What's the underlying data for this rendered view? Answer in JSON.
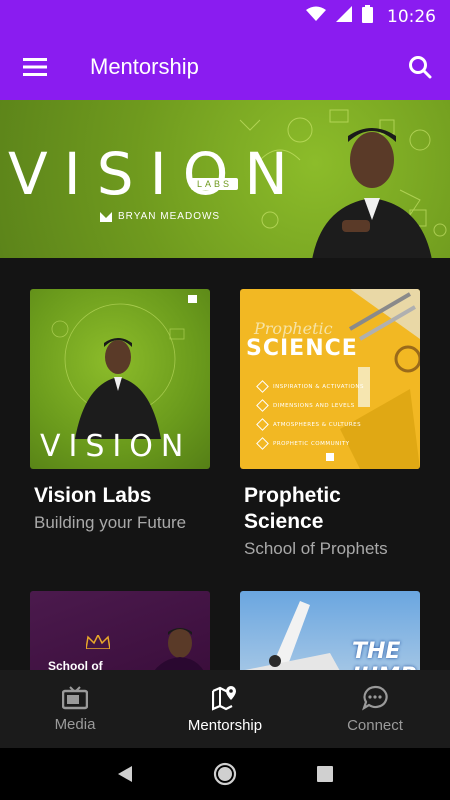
{
  "status_bar": {
    "time": "10:26",
    "icons": [
      "wifi-icon",
      "signal-icon",
      "battery-icon"
    ]
  },
  "app_bar": {
    "title": "Mentorship",
    "menu_icon": "hamburger-menu-icon",
    "search_icon": "search-icon",
    "color": "#8a1cf0"
  },
  "hero": {
    "title": "VISION",
    "badge": "LABS",
    "author": "BRYAN MEADOWS"
  },
  "cards": [
    {
      "title": "Vision Labs",
      "subtitle": "Building your Future",
      "thumb_word": "VISION"
    },
    {
      "title": "Prophetic Science",
      "subtitle": "School of Prophets",
      "thumb_script": "Prophetic",
      "thumb_big": "SCIENCE",
      "thumb_list": [
        "INSPIRATION & ACTIVATIONS",
        "DIMENSIONS AND LEVELS",
        "ATMOSPHERES & CULTURES",
        "PROPHETIC COMMUNITY"
      ]
    },
    {
      "thumb_text": "School of"
    },
    {
      "thumb_text": "THE JUMP"
    }
  ],
  "bottom_nav": {
    "items": [
      {
        "label": "Media",
        "icon": "tv-icon",
        "active": false
      },
      {
        "label": "Mentorship",
        "icon": "map-pin-icon",
        "active": true
      },
      {
        "label": "Connect",
        "icon": "chat-bubble-icon",
        "active": false
      }
    ]
  },
  "system_nav": {
    "icons": [
      "back-icon",
      "home-icon",
      "recents-icon"
    ]
  }
}
